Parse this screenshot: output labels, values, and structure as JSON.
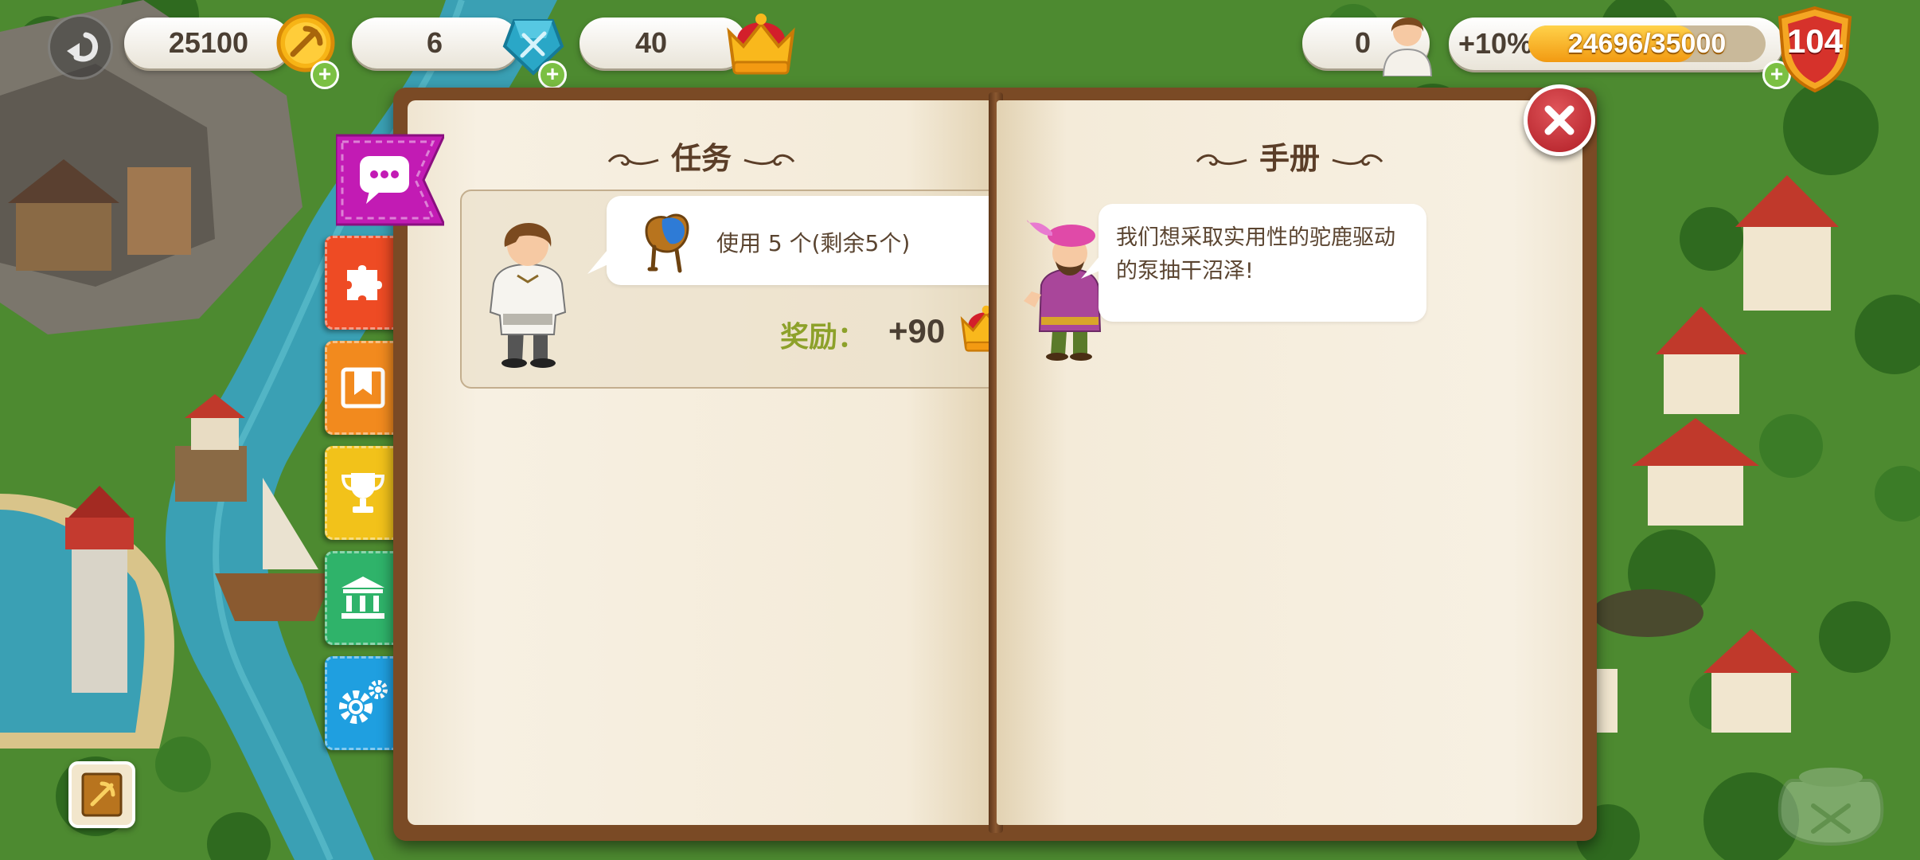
{
  "hud": {
    "gold": "25100",
    "gems": "6",
    "crowns": "40",
    "workers": "0",
    "xp_bonus": "+10%",
    "xp_text": "24696/35000",
    "xp_fraction": 0.7056,
    "level": "104",
    "plus_label": "+"
  },
  "quest_page": {
    "title": "任务",
    "task_text": "使用 5 个(剩余5个)",
    "reward_label": "奖励：",
    "reward_value": "+90"
  },
  "guide_page": {
    "title": "手册",
    "text": "我们想采取实用性的驼鹿驱动的泵抽干沼泽!"
  },
  "side_tabs": [
    {
      "name": "chat",
      "color": "#c21bb4",
      "icon": "chat-bubble-icon"
    },
    {
      "name": "puzzle",
      "color": "#ee4b24",
      "icon": "puzzle-icon"
    },
    {
      "name": "bookmark",
      "color": "#f28a1e",
      "icon": "bookmark-icon"
    },
    {
      "name": "trophy",
      "color": "#f2c21a",
      "icon": "trophy-icon"
    },
    {
      "name": "bank",
      "color": "#2fb36a",
      "icon": "bank-icon"
    },
    {
      "name": "settings",
      "color": "#1f9fe0",
      "icon": "gear-icon"
    }
  ],
  "colors": {
    "reward_label": "#8da12a",
    "close": "#c6242c",
    "book_cover": "#7a4a25"
  }
}
